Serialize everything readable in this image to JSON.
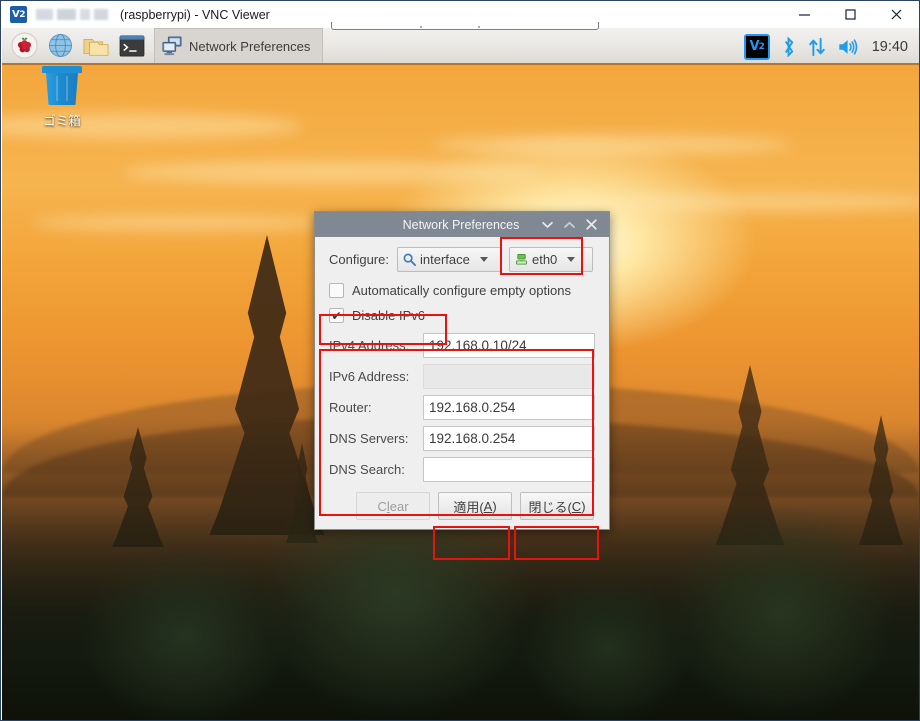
{
  "host_window": {
    "logo": "vnc-logo",
    "redacted_address": "",
    "title": "(raspberrypi) - VNC Viewer",
    "controls": [
      {
        "name": "minimize",
        "icon": "minimize-icon"
      },
      {
        "name": "maximize",
        "icon": "maximize-icon"
      },
      {
        "name": "close",
        "icon": "close-icon"
      }
    ]
  },
  "taskbar": {
    "launchers": [
      {
        "name": "raspberry-menu",
        "icon": "raspberry-icon",
        "label": ""
      },
      {
        "name": "web-browser",
        "icon": "globe-icon",
        "label": ""
      },
      {
        "name": "file-manager",
        "icon": "folder-icon",
        "label": ""
      },
      {
        "name": "terminal",
        "icon": "terminal-icon",
        "label": ""
      }
    ],
    "task_button": {
      "label": "Network Preferences",
      "icon": "network-preferences-icon"
    },
    "tray": {
      "vnc": "VNC",
      "bluetooth_icon": "bluetooth-icon",
      "network_icon": "network-updown-icon",
      "volume_icon": "volume-icon",
      "clock": "19:40"
    }
  },
  "desktop": {
    "icons": [
      {
        "name": "trash",
        "label": "ゴミ箱",
        "icon": "trash-icon"
      }
    ]
  },
  "dialog": {
    "title": "Network Preferences",
    "titlebar_buttons": {
      "shade_down": "▾",
      "shade_up": "▴",
      "close": "✕"
    },
    "configure": {
      "label": "Configure:",
      "scope": {
        "value": "interface",
        "icon": "interface-icon"
      },
      "target": {
        "value": "eth0",
        "icon": "ethernet-icon"
      }
    },
    "checkboxes": [
      {
        "name": "auto-configure-empty-options",
        "label": "Automatically configure empty options",
        "checked": false
      },
      {
        "name": "disable-ipv6",
        "label": "Disable IPv6",
        "checked": true
      }
    ],
    "fields": [
      {
        "name": "ipv4-address",
        "label": "IPv4 Address:",
        "value": "192.168.0.10/24",
        "disabled": false
      },
      {
        "name": "ipv6-address",
        "label": "IPv6 Address:",
        "value": "",
        "disabled": true
      },
      {
        "name": "router",
        "label": "Router:",
        "value": "192.168.0.254",
        "disabled": false
      },
      {
        "name": "dns-servers",
        "label": "DNS Servers:",
        "value": "192.168.0.254",
        "disabled": false
      },
      {
        "name": "dns-search",
        "label": "DNS Search:",
        "value": "",
        "disabled": false
      }
    ],
    "buttons": [
      {
        "name": "clear",
        "label": "Clear",
        "mnemonic": "l",
        "disabled": true
      },
      {
        "name": "apply",
        "label": "適用(A)",
        "mnemonic": "A",
        "disabled": false
      },
      {
        "name": "close",
        "label": "閉じる(C)",
        "mnemonic": "C",
        "disabled": false
      }
    ]
  },
  "annotations": {
    "color": "#e8120e",
    "boxes": [
      {
        "name": "highlight-eth0-combo"
      },
      {
        "name": "highlight-disable-ipv6"
      },
      {
        "name": "highlight-address-fields"
      },
      {
        "name": "highlight-apply-button"
      },
      {
        "name": "highlight-close-button"
      }
    ]
  }
}
